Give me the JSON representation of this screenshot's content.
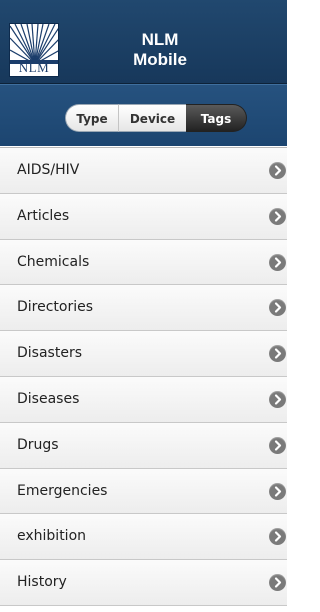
{
  "header": {
    "logo_text": "NLM",
    "title_line1": "NLM",
    "title_line2": "Mobile"
  },
  "segments": [
    {
      "label": "Type",
      "selected": false
    },
    {
      "label": "Device",
      "selected": false
    },
    {
      "label": "Tags",
      "selected": true
    }
  ],
  "list": {
    "items": [
      {
        "label": "AIDS/HIV"
      },
      {
        "label": "Articles"
      },
      {
        "label": "Chemicals"
      },
      {
        "label": "Directories"
      },
      {
        "label": "Disasters"
      },
      {
        "label": "Diseases"
      },
      {
        "label": "Drugs"
      },
      {
        "label": "Emergencies"
      },
      {
        "label": "exhibition"
      },
      {
        "label": "History"
      }
    ],
    "chevron_icon": "chevron-right-icon"
  },
  "colors": {
    "header_bg": "#1c4068",
    "segment_selected_bg": "#2e2e2e",
    "list_item_bg": "#f3f3f3",
    "chevron_bg": "#7a7a7a"
  }
}
